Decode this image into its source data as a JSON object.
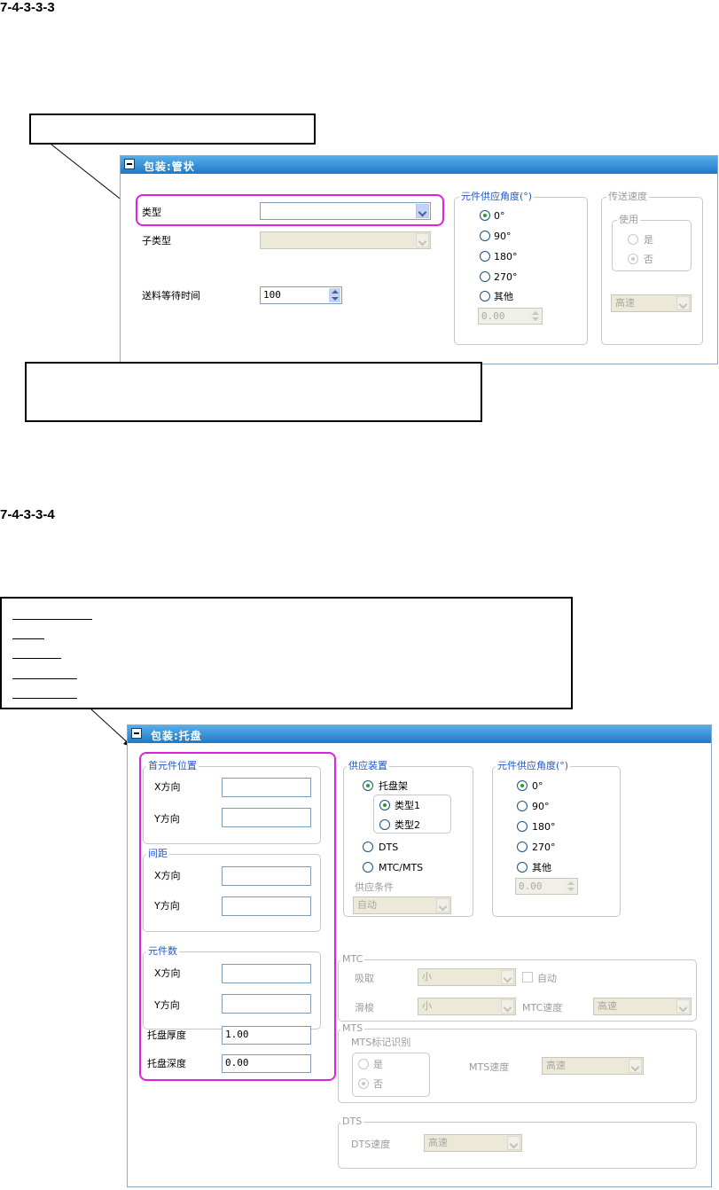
{
  "section1": {
    "number": "7-4-3-3-3",
    "panel_title": "包装:管状",
    "type_label": "类型",
    "type_value": "",
    "subtype_label": "子类型",
    "subtype_value": "",
    "feed_wait_label": "送料等待时间",
    "feed_wait_value": "100",
    "angle_group_label": "元件供应角度(°)",
    "angle_options": [
      "0°",
      "90°",
      "180°",
      "270°",
      "其他"
    ],
    "angle_other_value": "0.00",
    "transfer_group_label": "传送速度",
    "use_group_label": "使用",
    "use_yes": "是",
    "use_no": "否",
    "speed_value": "高速"
  },
  "section2": {
    "number": "7-4-3-3-4",
    "panel_title": "包装:托盘",
    "first_pos_label": "首元件位置",
    "pitch_label": "间距",
    "count_label": "元件数",
    "x_dir": "X方向",
    "y_dir": "Y方向",
    "tray_thickness_label": "托盘厚度",
    "tray_thickness_value": "1.00",
    "tray_depth_label": "托盘深度",
    "tray_depth_value": "0.00",
    "supply_device_label": "供应装置",
    "tray_rack": "托盘架",
    "type1": "类型1",
    "type2": "类型2",
    "dts": "DTS",
    "mtc_mts": "MTC/MTS",
    "supply_condition_label": "供应条件",
    "supply_condition_value": "自动",
    "angle_group_label": "元件供应角度(°)",
    "angle_options": [
      "0°",
      "90°",
      "180°",
      "270°",
      "其他"
    ],
    "angle_other_value": "0.00",
    "mtc_label": "MTC",
    "suction_label": "吸取",
    "suction_value": "小",
    "auto_label": "自动",
    "slide_label": "滑梭",
    "slide_value": "小",
    "mtc_speed_label": "MTC速度",
    "mtc_speed_value": "高速",
    "mts_label": "MTS",
    "mts_mark_label": "MTS标记识别",
    "mts_yes": "是",
    "mts_no": "否",
    "mts_speed_label": "MTS速度",
    "mts_speed_value": "高速",
    "dts_group_label": "DTS",
    "dts_speed_label": "DTS速度",
    "dts_speed_value": "高速"
  }
}
